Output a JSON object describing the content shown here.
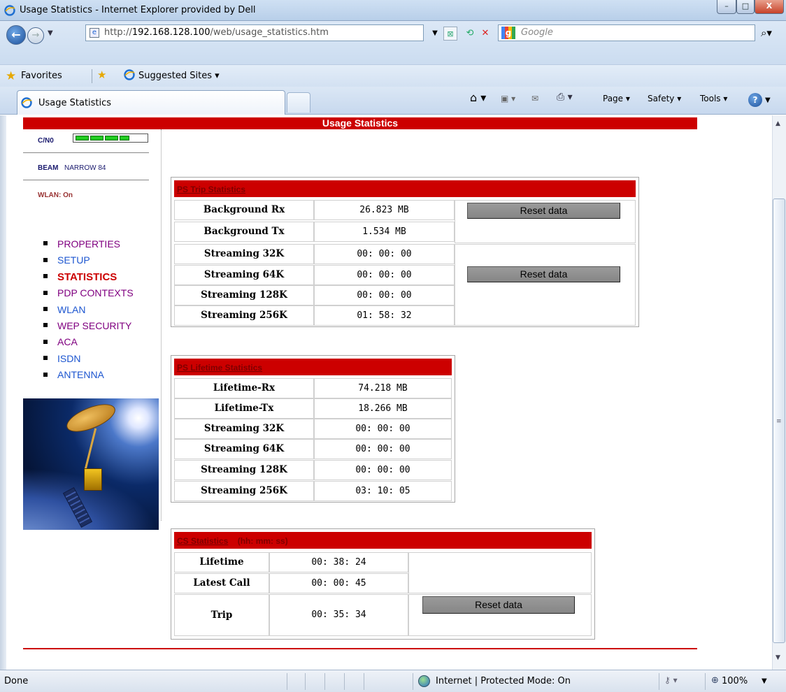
{
  "window": {
    "title": "Usage Statistics - Internet Explorer provided by Dell",
    "min": "–",
    "max": "□",
    "close": "X"
  },
  "address_bar": {
    "url_prefix": "http://",
    "url_host": "192.168.128.100",
    "url_path": "/web/usage_statistics.htm",
    "search_placeholder": "Google"
  },
  "favorites_bar": {
    "favorites_label": "Favorites",
    "suggested_sites_label": "Suggested Sites ▾"
  },
  "tabs": [
    {
      "label": "Usage Statistics"
    }
  ],
  "command_bar": {
    "page": "Page ▾",
    "safety": "Safety ▾",
    "tools": "Tools ▾",
    "help": "?"
  },
  "page": {
    "header": "Usage Statistics",
    "sidebar": {
      "cn0_label": "C/N0",
      "cn0_level": "4 of 5",
      "beam_label": "BEAM",
      "beam_value": "NARROW 84",
      "wlan_status": "WLAN: On",
      "menu": [
        {
          "label": "PROPERTIES",
          "style": "purple"
        },
        {
          "label": "SETUP",
          "style": "blue"
        },
        {
          "label": "STATISTICS",
          "style": "active"
        },
        {
          "label": "PDP CONTEXTS",
          "style": "purple"
        },
        {
          "label": "WLAN",
          "style": "blue"
        },
        {
          "label": "WEP SECURITY",
          "style": "purple"
        },
        {
          "label": "ACA",
          "style": "purple"
        },
        {
          "label": "ISDN",
          "style": "blue"
        },
        {
          "label": "ANTENNA",
          "style": "blue"
        }
      ]
    },
    "ps_trip": {
      "title": "PS Trip Statistics",
      "rows": [
        {
          "label": "Background Rx",
          "value": "26.823 MB"
        },
        {
          "label": "Background Tx",
          "value": "1.534 MB"
        },
        {
          "label": "Streaming 32K",
          "value": "00: 00: 00"
        },
        {
          "label": "Streaming 64K",
          "value": "00: 00: 00"
        },
        {
          "label": "Streaming 128K",
          "value": "00: 00: 00"
        },
        {
          "label": "Streaming 256K",
          "value": "01: 58: 32"
        }
      ],
      "reset_background": "Reset data",
      "reset_streaming": "Reset data"
    },
    "ps_lifetime": {
      "title": "PS Lifetime Statistics",
      "rows": [
        {
          "label": "Lifetime-Rx",
          "value": "74.218 MB"
        },
        {
          "label": "Lifetime-Tx",
          "value": "18.266 MB"
        },
        {
          "label": "Streaming 32K",
          "value": "00: 00: 00"
        },
        {
          "label": "Streaming 64K",
          "value": "00: 00: 00"
        },
        {
          "label": "Streaming 128K",
          "value": "00: 00: 00"
        },
        {
          "label": "Streaming 256K",
          "value": "03: 10: 05"
        }
      ]
    },
    "cs": {
      "title": "CS Statistics",
      "unit": "(hh: mm: ss)",
      "rows": [
        {
          "label": "Lifetime",
          "value": "00: 38: 24"
        },
        {
          "label": "Latest Call",
          "value": "00: 00: 45"
        },
        {
          "label": "Trip",
          "value": "00: 35: 34"
        }
      ],
      "reset": "Reset data"
    }
  },
  "status_bar": {
    "status": "Done",
    "zone": "Internet | Protected Mode: On",
    "zoom": "100%"
  },
  "colors": {
    "header_red": "#cc0000",
    "active_menu": "#cc0000",
    "menu_purple": "#800080",
    "menu_blue": "#1d56d0"
  }
}
